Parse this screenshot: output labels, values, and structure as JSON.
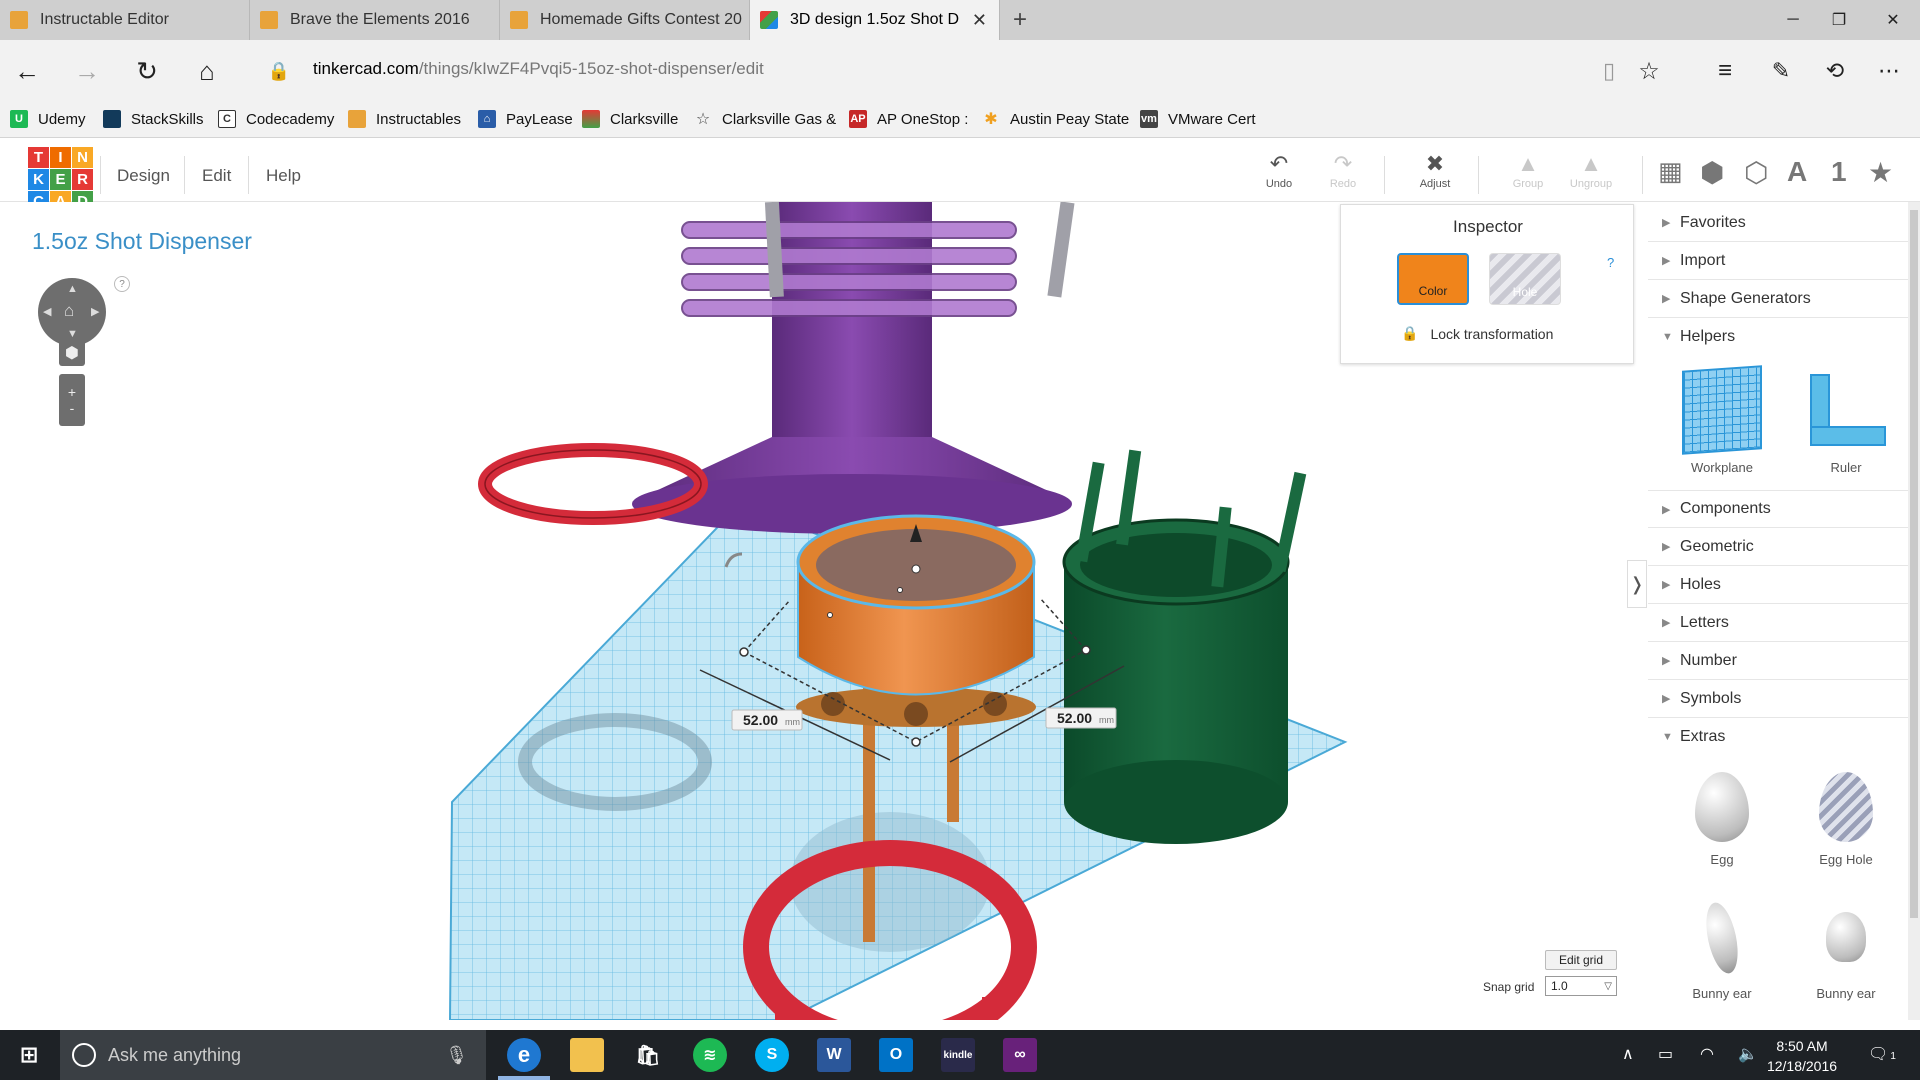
{
  "browser": {
    "tabs": [
      {
        "title": "Instructable Editor",
        "active": false
      },
      {
        "title": "Brave the Elements 2016",
        "active": false
      },
      {
        "title": "Homemade Gifts Contest 20",
        "active": false
      },
      {
        "title": "3D design 1.5oz Shot D",
        "active": true
      }
    ],
    "url_host": "tinkercad.com",
    "url_path": "/things/kIwZF4Pvqi5-15oz-shot-dispenser/edit",
    "bookmarks": [
      "Udemy",
      "StackSkills",
      "Codecademy",
      "Instructables",
      "PayLease",
      "Clarksville",
      "Clarksville Gas &",
      "AP OneStop :",
      "Austin Peay State",
      "VMware Cert"
    ]
  },
  "app": {
    "logo_letters": [
      "T",
      "I",
      "N",
      "K",
      "E",
      "R",
      "C",
      "A",
      "D"
    ],
    "menu": [
      "Design",
      "Edit",
      "Help"
    ],
    "toolbar": {
      "undo": "Undo",
      "redo": "Redo",
      "adjust": "Adjust",
      "group": "Group",
      "ungroup": "Ungroup"
    },
    "view_letter": "A",
    "view_number": "1"
  },
  "design": {
    "title": "1.5oz Shot Dispenser",
    "dim_left": "52.00",
    "dim_right": "52.00",
    "dim_unit": "mm",
    "edit_grid_label": "Edit grid",
    "snap_grid_label": "Snap grid",
    "snap_grid_value": "1.0",
    "nav_help": "?"
  },
  "inspector": {
    "title": "Inspector",
    "color_label": "Color",
    "hole_label": "Hole",
    "help": "?",
    "lock_label": "Lock transformation",
    "color_value": "#f0841b"
  },
  "panel": {
    "categories_top": [
      "Favorites",
      "Import",
      "Shape Generators"
    ],
    "helpers_label": "Helpers",
    "helpers": [
      "Workplane",
      "Ruler"
    ],
    "categories_mid": [
      "Components",
      "Geometric",
      "Holes",
      "Letters",
      "Number",
      "Symbols"
    ],
    "extras_label": "Extras",
    "extras": [
      "Egg",
      "Egg Hole",
      "Bunny ear",
      "Bunny ear"
    ]
  },
  "taskbar": {
    "search_placeholder": "Ask me anything",
    "time": "8:50 AM",
    "date": "12/18/2016",
    "notifications": "1"
  }
}
